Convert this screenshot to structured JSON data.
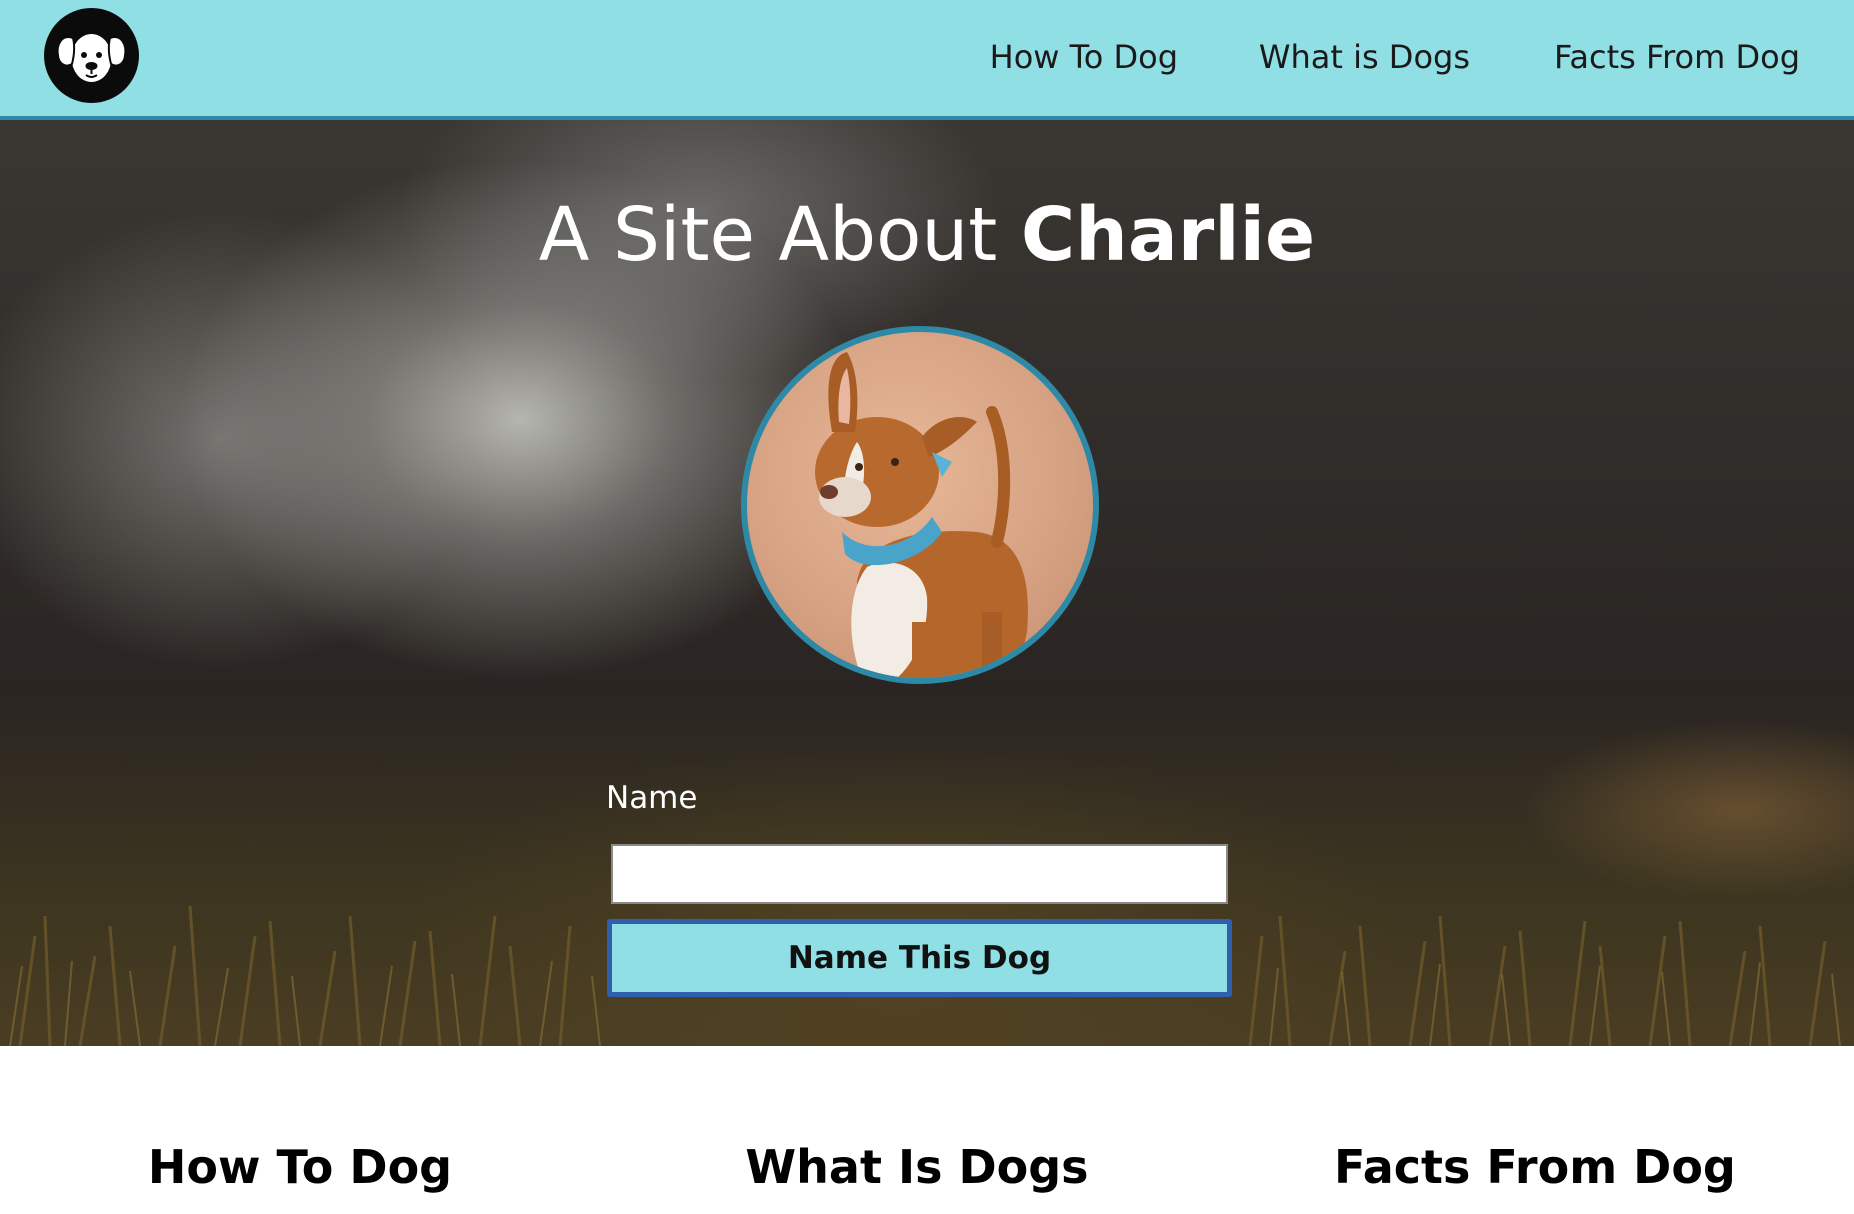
{
  "header": {
    "logo_icon": "dog-face-icon",
    "nav": [
      {
        "label": "How To Dog"
      },
      {
        "label": "What is Dogs"
      },
      {
        "label": "Facts From Dog"
      }
    ]
  },
  "hero": {
    "title_prefix": "A Site About",
    "title_name": "Charlie",
    "photo": "dog-portrait",
    "form": {
      "name_label": "Name",
      "name_value": "",
      "button_label": "Name This Dog"
    }
  },
  "sections": [
    {
      "title": "How To Dog"
    },
    {
      "title": "What Is Dogs"
    },
    {
      "title": "Facts From Dog"
    }
  ],
  "colors": {
    "header_bg": "#90dfe5",
    "accent_border": "#2e89a7",
    "button_border": "#2f5fae"
  }
}
